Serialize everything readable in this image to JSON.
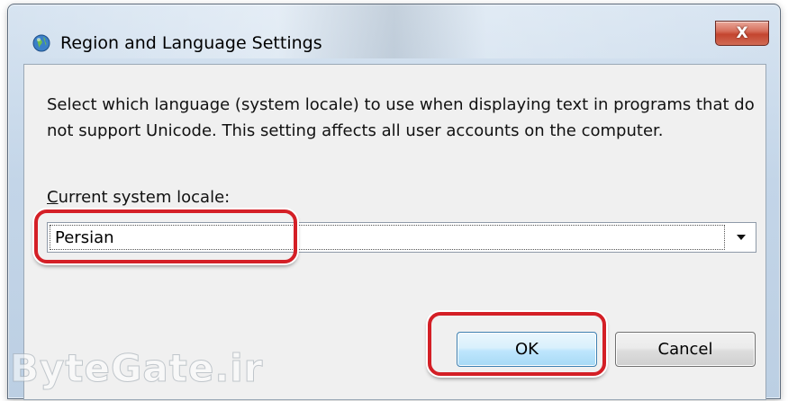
{
  "window": {
    "title": "Region and Language Settings",
    "close_label": "X",
    "icon": "globe-icon"
  },
  "description": "Select which language (system locale) to use when displaying text in programs that do not support Unicode. This setting affects all user accounts on the computer.",
  "locale": {
    "label_accel": "C",
    "label_rest": "urrent system locale:",
    "selected": "Persian",
    "arrow_icon": "dropdown-arrow-icon"
  },
  "buttons": {
    "ok": "OK",
    "cancel": "Cancel"
  },
  "watermark": "ByteGate.ir",
  "colors": {
    "highlight": "#d41f26",
    "close_button": "#c4452f",
    "ok_border": "#3c7fb1"
  }
}
